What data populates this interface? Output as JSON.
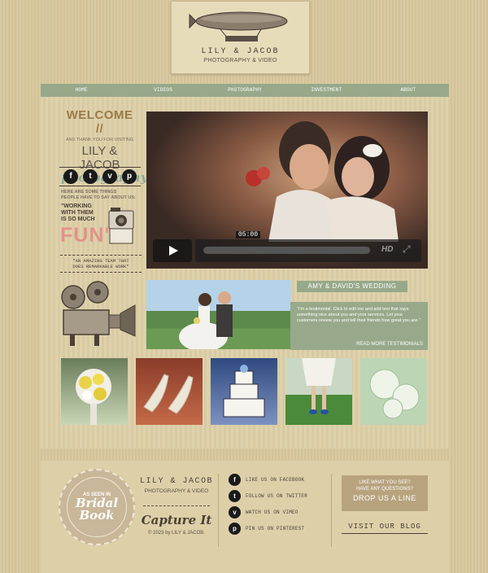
{
  "brand": {
    "name": "LILY & JACOB",
    "tagline": "PHOTOGRAPHY & VIDEO"
  },
  "nav": {
    "items": [
      {
        "label": "HOME"
      },
      {
        "label": "VIDEOS"
      },
      {
        "label": "PHOTOGRAPHY"
      },
      {
        "label": "INVESTMENT"
      },
      {
        "label": "ABOUT"
      }
    ]
  },
  "welcome": {
    "title": "WELCOME //",
    "thanks": "AND THANK YOU FOR VISITING",
    "names": "LILY & JACOB",
    "photography": "photography",
    "things_line1": "HERE ARE SOME THINGS",
    "things_line2": "PEOPLE HAVE TO SAY ABOUT US:",
    "quote_line1": "\"WORKING",
    "quote_line2": "WITH THEM",
    "quote_line3": "IS SO MUCH",
    "fun": "FUN\"",
    "team_line1": "\"AN AMAZING TEAM THAT",
    "team_line2": "DOES REMARKABLE WORK\""
  },
  "social": {
    "facebook": "f",
    "twitter": "t",
    "vimeo": "v",
    "pinterest": "p"
  },
  "video": {
    "time": "05:00",
    "hd": "HD"
  },
  "feature": {
    "title": "AMY & DAVID'S WEDDING",
    "testimonial": "\"I'm a testimonial. Click to edit me and add text that says something nice about you and your services. Let your customers review you and tell their friends how great you are.\"",
    "read_more": "READ MORE TESTIMONIALS"
  },
  "footer": {
    "badge_top": "AS SEEN IN",
    "badge_line1": "Bridal",
    "badge_line2": "Book",
    "name": "LILY & JACOB",
    "sub": "PHOTOGRAPHY & VIDEO",
    "capture": "Capture It",
    "copyright": "© 2023 by LILY & JACOB.",
    "follow": [
      {
        "icon": "f",
        "label": "LIKE US ON FACEBOOK"
      },
      {
        "icon": "t",
        "label": "FOLLOW US ON TWITTER"
      },
      {
        "icon": "v",
        "label": "WATCH US ON VIMEO"
      },
      {
        "icon": "p",
        "label": "PIN US ON PINTEREST"
      }
    ],
    "contact_q1": "LIKE WHAT YOU SEE?",
    "contact_q2": "HAVE ANY QUESTIONS?",
    "contact_cta": "DROP US A LINE",
    "blog": "VISIT OUR BLOG"
  }
}
